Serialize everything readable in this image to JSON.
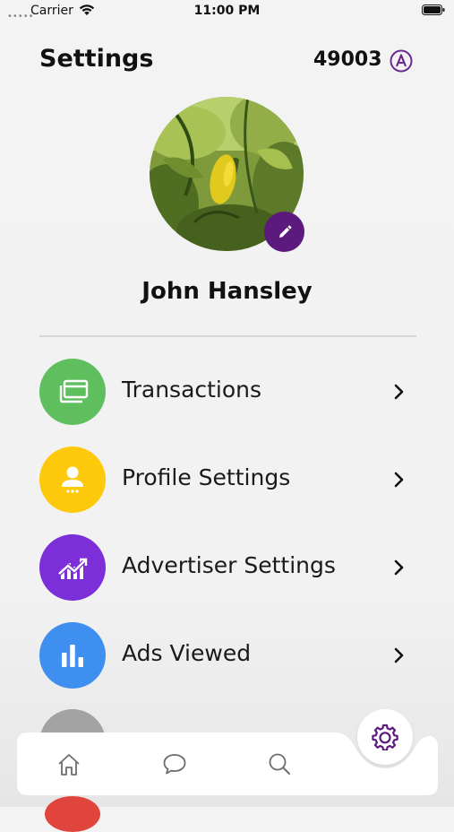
{
  "status_bar": {
    "signal_dots": "•••••",
    "carrier": "Carrier",
    "time": "11:00 PM",
    "wifi_icon": "wifi-icon",
    "battery_icon": "battery-icon"
  },
  "header": {
    "title": "Settings",
    "points": "49003",
    "points_icon": "token-a-icon",
    "accent_color": "#6b2c91"
  },
  "profile": {
    "name": "John Hansley",
    "avatar_icon": "profile-photo",
    "edit_icon": "pencil-icon",
    "edit_color": "#5d1a7e"
  },
  "menu": {
    "items": [
      {
        "label": "Transactions",
        "icon": "cards-icon",
        "color": "#5fbf5f"
      },
      {
        "label": "Profile Settings",
        "icon": "person-icon",
        "color": "#fec90a"
      },
      {
        "label": "Advertiser Settings",
        "icon": "chart-trend-icon",
        "color": "#7c2fd9"
      },
      {
        "label": "Ads Viewed",
        "icon": "bar-chart-icon",
        "color": "#3e8ff0"
      }
    ],
    "chevron_icon": "chevron-right-icon"
  },
  "tab_bar": {
    "tabs": [
      {
        "icon": "home-icon"
      },
      {
        "icon": "chat-icon"
      },
      {
        "icon": "search-icon"
      },
      {
        "icon": "gear-icon",
        "active": true
      }
    ]
  }
}
